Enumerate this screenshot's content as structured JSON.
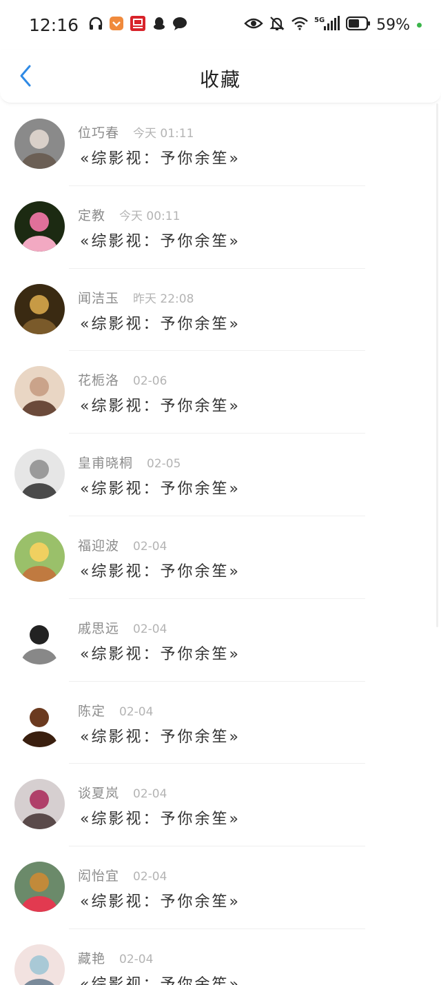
{
  "status_bar": {
    "time": "12:16",
    "left_icons": [
      "headphones-icon",
      "taobao-coupon-icon",
      "taobao-icon",
      "qq-icon",
      "chat-bubble-icon"
    ],
    "right_icons": [
      "eye-icon",
      "bell-muted-icon",
      "wifi-icon",
      "signal-5g-icon",
      "battery-icon"
    ],
    "network_label": "5G",
    "battery_text": "59%",
    "colors": {
      "dot": "#3bb54a"
    }
  },
  "header": {
    "title": "收藏",
    "back_icon": "chevron-left-icon",
    "colors": {
      "back": "#2f8ae5"
    }
  },
  "favorites": [
    {
      "name": "位巧春",
      "time": "今天 01:11",
      "book": "«综影视：予你余笙»"
    },
    {
      "name": "定教",
      "time": "今天 00:11",
      "book": "«综影视：予你余笙»"
    },
    {
      "name": "闻洁玉",
      "time": "昨天 22:08",
      "book": "«综影视：予你余笙»"
    },
    {
      "name": "花栀洛",
      "time": "02-06",
      "book": "«综影视：予你余笙»"
    },
    {
      "name": "皇甫晓桐",
      "time": "02-05",
      "book": "«综影视：予你余笙»"
    },
    {
      "name": "福迎波",
      "time": "02-04",
      "book": "«综影视：予你余笙»"
    },
    {
      "name": "戚思远",
      "time": "02-04",
      "book": "«综影视：予你余笙»"
    },
    {
      "name": "陈定",
      "time": "02-04",
      "book": "«综影视：予你余笙»"
    },
    {
      "name": "谈夏岚",
      "time": "02-04",
      "book": "«综影视：予你余笙»"
    },
    {
      "name": "闳怡宜",
      "time": "02-04",
      "book": "«综影视：予你余笙»"
    },
    {
      "name": "藏艳",
      "time": "02-04",
      "book": "«综影视：予你余笙»"
    }
  ]
}
